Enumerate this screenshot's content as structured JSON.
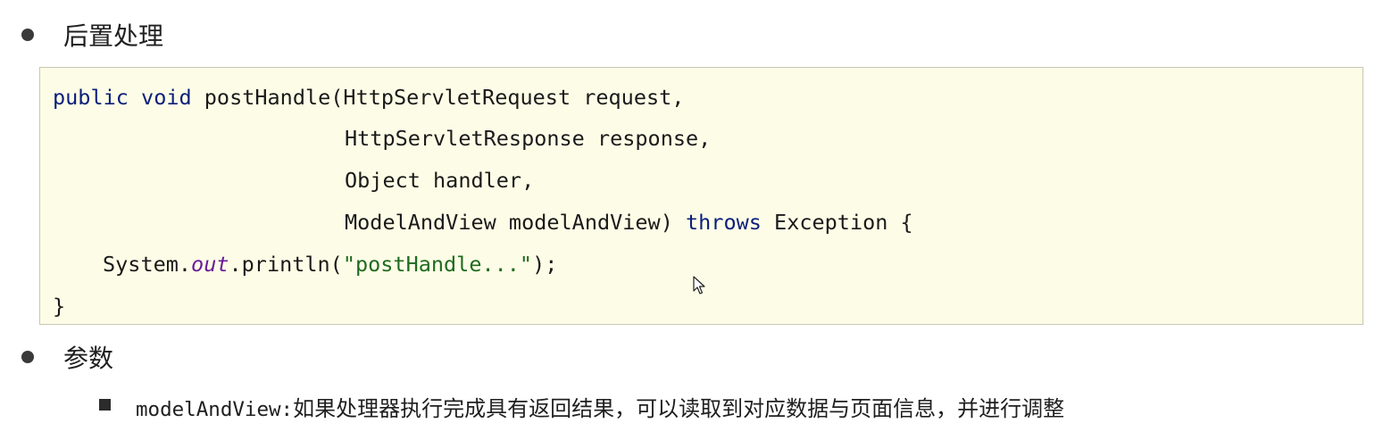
{
  "section1": {
    "heading": "后置处理"
  },
  "code": {
    "line1": {
      "kw1": "public",
      "kw2": "void",
      "rest": " postHandle(HttpServletRequest request,"
    },
    "line2": "HttpServletResponse response,",
    "line3": "Object handler,",
    "line4": {
      "before": "ModelAndView modelAndView) ",
      "kw": "throws",
      "after": " Exception {"
    },
    "line5": {
      "before": "System.",
      "italic": "out",
      "middle": ".println(",
      "string": "\"postHandle...\"",
      "after": ");"
    },
    "line6": "}"
  },
  "section2": {
    "heading": "参数",
    "sub_item": {
      "term": "modelAndView:",
      "description": "如果处理器执行完成具有返回结果，可以读取到对应数据与页面信息，并进行调整"
    }
  },
  "colors": {
    "code_background": "#fdfde7",
    "keyword": "#0b1f7a",
    "string": "#1f6b1f",
    "static_field": "#6a1b9a"
  }
}
